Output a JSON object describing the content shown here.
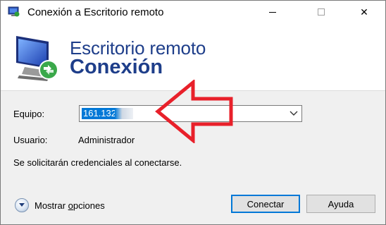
{
  "window": {
    "title": "Conexión a Escritorio remoto",
    "minimize_glyph": "",
    "maximize_glyph": "",
    "close_glyph": "✕"
  },
  "banner": {
    "line1": "Escritorio remoto",
    "line2": "Conexión",
    "text_color": "#1e3e8a"
  },
  "form": {
    "computer_label": "Equipo:",
    "computer_value": "161.132",
    "computer_value_selected": true,
    "username_label": "Usuario:",
    "username_value": "Administrador",
    "notice": "Se solicitarán credenciales al conectarse."
  },
  "footer": {
    "options_label_prefix": "Mostrar ",
    "options_label_underlined": "o",
    "options_label_suffix": "pciones",
    "connect_label": "Conectar",
    "help_label": "Ayuda"
  },
  "icons": {
    "app": "remote-desktop-icon",
    "banner": "remote-desktop-monitor-icon",
    "combo_arrow": "chevron-down-icon",
    "options": "expand-circle-icon",
    "annotation": "red-arrow-annotation"
  },
  "colors": {
    "selection": "#0078d7",
    "default_button_border": "#0078d7",
    "annotation_red": "#e8202a"
  }
}
